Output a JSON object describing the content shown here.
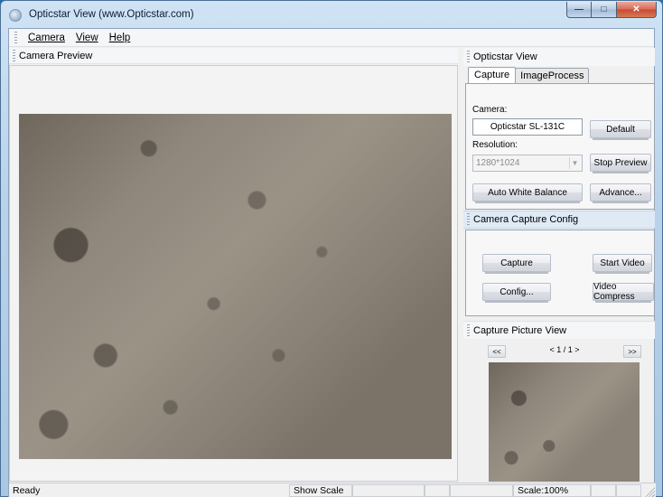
{
  "window": {
    "title": "Opticstar View (www.Opticstar.com)"
  },
  "menu": {
    "items": [
      "Camera",
      "View",
      "Help"
    ]
  },
  "left_pane": {
    "header": "Camera Preview"
  },
  "right_pane": {
    "header": "Opticstar View",
    "tabs": [
      "Capture",
      "ImageProcess"
    ],
    "capture": {
      "camera_label": "Camera:",
      "camera_value": "Opticstar SL-131C",
      "default_button": "Default",
      "resolution_label": "Resolution:",
      "resolution_value": "1280*1024",
      "stop_preview_button": "Stop Preview",
      "auto_white_balance_button": "Auto White Balance",
      "advance_button": "Advance..."
    },
    "capture_config": {
      "header": "Camera Capture Config",
      "capture_button": "Capture",
      "start_video_button": "Start Video",
      "config_button": "Config...",
      "video_compress_button": "Video Compress"
    },
    "picture_view": {
      "header": "Capture Picture View",
      "prev_button": "<<",
      "next_button": ">>",
      "page_indicator": "< 1 / 1 >"
    }
  },
  "status_bar": {
    "status": "Ready",
    "show_scale": "Show Scale",
    "scale": "Scale:100%"
  }
}
